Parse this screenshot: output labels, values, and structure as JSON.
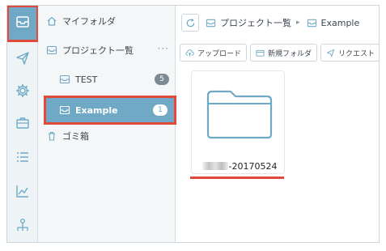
{
  "rail": {
    "items": [
      {
        "name": "folder-box-icon",
        "active": true
      },
      {
        "name": "send-icon",
        "active": false
      },
      {
        "name": "gear-icon",
        "active": false
      },
      {
        "name": "briefcase-icon",
        "active": false
      },
      {
        "name": "list-icon",
        "active": false
      },
      {
        "name": "chart-icon",
        "active": false
      },
      {
        "name": "org-chart-icon",
        "active": false
      }
    ]
  },
  "tree": {
    "my_folder": "マイフォルダ",
    "project_list": "プロジェクト一覧",
    "project_more": "···",
    "projects": [
      {
        "label": "TEST",
        "count": "5"
      },
      {
        "label": "Example",
        "count": "1"
      }
    ],
    "trash": "ゴミ箱"
  },
  "breadcrumb": {
    "root": "プロジェクト一覧",
    "separator": "▸",
    "current": "Example"
  },
  "toolbar": {
    "upload": "アップロード",
    "new_folder": "新規フォルダ",
    "request": "リクエスト"
  },
  "content": {
    "folder_name_suffix": "-20170524"
  },
  "colors": {
    "accent": "#6fa9c5",
    "highlight": "#e2493d",
    "icon": "#6fa9c5"
  }
}
